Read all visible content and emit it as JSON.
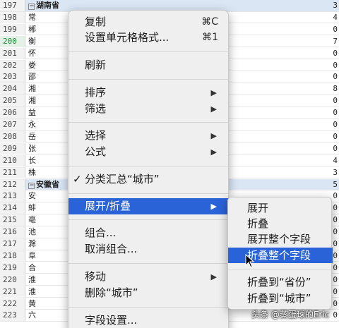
{
  "sheet": {
    "rows": [
      {
        "num": "197",
        "label": "湖南省",
        "group": true,
        "right": "3"
      },
      {
        "num": "198",
        "label": "常",
        "right": "4"
      },
      {
        "num": "199",
        "label": "郴",
        "right": "0"
      },
      {
        "num": "200",
        "label": "衡",
        "right": "7",
        "active": true
      },
      {
        "num": "201",
        "label": "怀",
        "right": "0"
      },
      {
        "num": "202",
        "label": "娄",
        "right": "0"
      },
      {
        "num": "203",
        "label": "邵",
        "right": "0"
      },
      {
        "num": "204",
        "label": "湘",
        "right": "8"
      },
      {
        "num": "205",
        "label": "湘",
        "right": "0"
      },
      {
        "num": "206",
        "label": "益",
        "right": "0"
      },
      {
        "num": "207",
        "label": "永",
        "right": "0"
      },
      {
        "num": "208",
        "label": "岳",
        "right": "0"
      },
      {
        "num": "209",
        "label": "张",
        "right": "0"
      },
      {
        "num": "210",
        "label": "长",
        "right": "4"
      },
      {
        "num": "211",
        "label": "株",
        "right": "3"
      },
      {
        "num": "212",
        "label": "安徽省",
        "group": true,
        "right": "5"
      },
      {
        "num": "213",
        "label": "安",
        "right": "0"
      },
      {
        "num": "214",
        "label": "蚌",
        "right": "0"
      },
      {
        "num": "215",
        "label": "亳",
        "right": "0"
      },
      {
        "num": "216",
        "label": "池",
        "right": "0"
      },
      {
        "num": "217",
        "label": "滁",
        "right": "0"
      },
      {
        "num": "218",
        "label": "阜",
        "right": "0"
      },
      {
        "num": "219",
        "label": "合",
        "right": "0"
      },
      {
        "num": "220",
        "label": "淮",
        "right": "0"
      },
      {
        "num": "221",
        "label": "淮",
        "right": "0"
      },
      {
        "num": "222",
        "label": "黄",
        "right": "0"
      },
      {
        "num": "223",
        "label": "六",
        "right": "0"
      }
    ]
  },
  "context_menu": {
    "copy": {
      "label": "复制",
      "shortcut": "⌘C"
    },
    "format_cells": {
      "label": "设置单元格格式...",
      "shortcut": "⌘1"
    },
    "refresh": {
      "label": "刷新"
    },
    "sort": {
      "label": "排序"
    },
    "filter": {
      "label": "筛选"
    },
    "select": {
      "label": "选择"
    },
    "formula": {
      "label": "公式"
    },
    "subtotal": {
      "label": "分类汇总“城市”",
      "check": "✓"
    },
    "expand_collapse": {
      "label": "展开/折叠"
    },
    "group": {
      "label": "组合..."
    },
    "ungroup": {
      "label": "取消组合..."
    },
    "move": {
      "label": "移动"
    },
    "remove": {
      "label": "删除“城市”"
    },
    "field_settings": {
      "label": "字段设置..."
    },
    "submenu_arrow": "▶"
  },
  "submenu": {
    "expand": "展开",
    "collapse": "折叠",
    "expand_field": "展开整个字段",
    "collapse_field": "折叠整个字段",
    "collapse_to_province": "折叠到“省份”",
    "collapse_to_city": "折叠到“城市”"
  },
  "watermark": "头条 @蒸蛋球的Eric",
  "colors": {
    "highlight": "#2a63d8",
    "menu_bg": "#efefef"
  }
}
